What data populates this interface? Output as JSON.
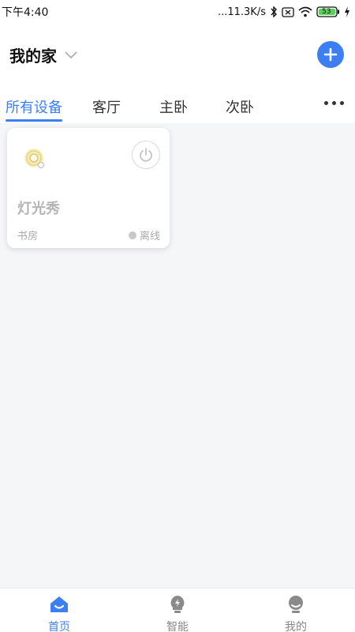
{
  "status_bar": {
    "time": "下午4:40",
    "network_speed": "...11.3K/s",
    "battery": "53"
  },
  "header": {
    "home_name": "我的家"
  },
  "tabs": [
    {
      "label": "所有设备",
      "active": true
    },
    {
      "label": "客厅",
      "active": false
    },
    {
      "label": "主卧",
      "active": false
    },
    {
      "label": "次卧",
      "active": false
    },
    {
      "label": "",
      "active": false
    }
  ],
  "devices": [
    {
      "name": "灯光秀",
      "room": "书房",
      "status": "离线",
      "icon": "light-show-icon",
      "online": false
    }
  ],
  "bottom_nav": [
    {
      "label": "首页",
      "icon": "home-icon",
      "active": true
    },
    {
      "label": "智能",
      "icon": "smart-bulb-icon",
      "active": false
    },
    {
      "label": "我的",
      "icon": "profile-icon",
      "active": false
    }
  ],
  "colors": {
    "accent": "#3d7ff2",
    "offline_dot": "#c8c8c8"
  }
}
